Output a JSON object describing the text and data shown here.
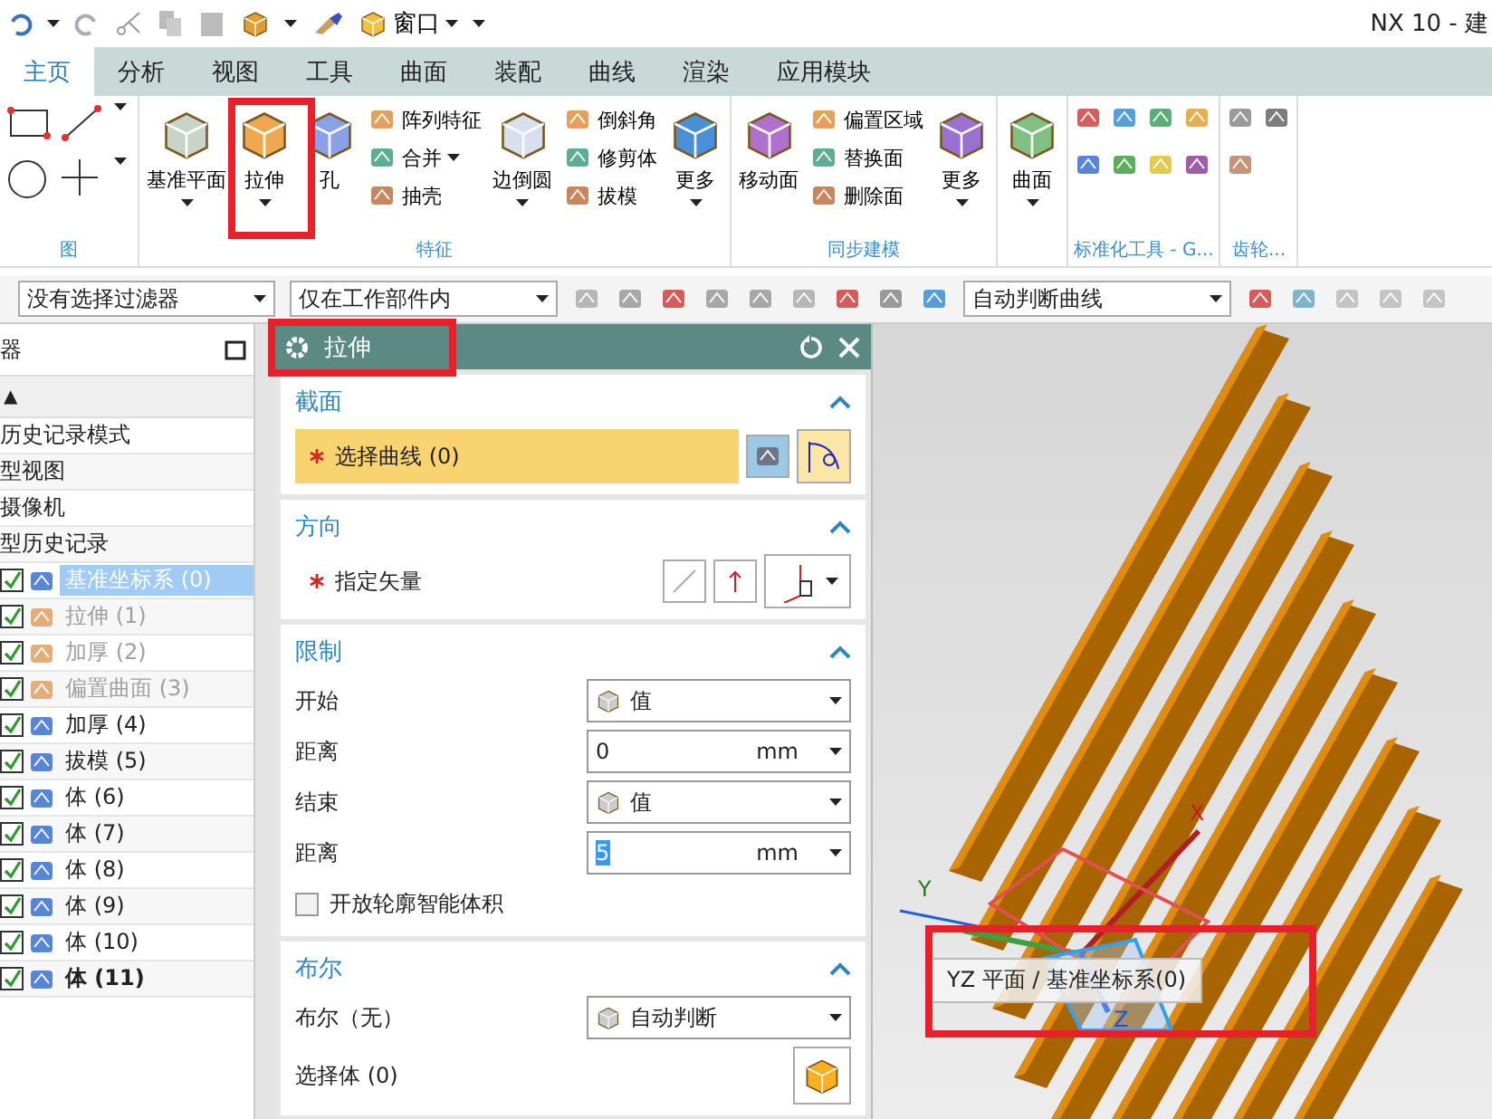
{
  "window": {
    "title": "NX 10 - 建",
    "menu": "窗口"
  },
  "tabs": [
    {
      "label": "主页",
      "selected": true
    },
    {
      "label": "分析",
      "selected": false
    },
    {
      "label": "视图",
      "selected": false
    },
    {
      "label": "工具",
      "selected": false
    },
    {
      "label": "曲面",
      "selected": false
    },
    {
      "label": "装配",
      "selected": false
    },
    {
      "label": "曲线",
      "selected": false
    },
    {
      "label": "渲染",
      "selected": false
    },
    {
      "label": "应用模块",
      "selected": false
    }
  ],
  "ribbon": {
    "groups": [
      {
        "kind": "sketch",
        "label": "图"
      },
      {
        "kind": "tools",
        "label": "特征",
        "items": [
          {
            "kind": "large",
            "label": "基准平面",
            "menu": true
          },
          {
            "kind": "large",
            "label": "拉伸",
            "menu": true
          },
          {
            "kind": "large",
            "label": "孔",
            "menu": false
          },
          {
            "kind": "small",
            "label": "阵列特征",
            "menu": false
          },
          {
            "kind": "small",
            "label": "合并",
            "menu": true
          },
          {
            "kind": "small",
            "label": "抽壳",
            "menu": false
          },
          {
            "kind": "large",
            "label": "边倒圆",
            "menu": true
          },
          {
            "kind": "small",
            "label": "倒斜角",
            "menu": false
          },
          {
            "kind": "small",
            "label": "修剪体",
            "menu": false
          },
          {
            "kind": "small",
            "label": "拔模",
            "menu": false
          },
          {
            "kind": "large",
            "label": "更多",
            "menu": true
          }
        ]
      },
      {
        "kind": "tools",
        "label": "同步建模",
        "items": [
          {
            "kind": "large",
            "label": "移动面",
            "menu": false
          },
          {
            "kind": "small",
            "label": "偏置区域",
            "menu": false
          },
          {
            "kind": "small",
            "label": "替换面",
            "menu": false
          },
          {
            "kind": "small",
            "label": "删除面",
            "menu": false
          },
          {
            "kind": "large",
            "label": "更多",
            "menu": true
          }
        ]
      },
      {
        "kind": "tools",
        "items": [
          {
            "kind": "large",
            "label": "曲面",
            "menu": true
          }
        ]
      },
      {
        "kind": "icons",
        "label": "标准化工具 - G..."
      },
      {
        "kind": "icons_narrow",
        "label": "齿轮..."
      }
    ]
  },
  "filter_bar": {
    "type_filter": "没有选择过滤器",
    "scope": "仅在工作部件内",
    "curve_rule": "自动判断曲线"
  },
  "navigator": {
    "title": "器",
    "sort_mark": "▲",
    "rows": [
      {
        "label": "历史记录模式"
      },
      {
        "label": "型视图"
      },
      {
        "label": "摄像机"
      },
      {
        "label": "型历史记录"
      }
    ],
    "features": [
      {
        "label": "基准坐标系 (0)",
        "checked": true,
        "selected": true,
        "suppressed": false,
        "current": false
      },
      {
        "label": "拉伸 (1)",
        "checked": true,
        "selected": false,
        "suppressed": true,
        "current": false
      },
      {
        "label": "加厚 (2)",
        "checked": true,
        "selected": false,
        "suppressed": true,
        "current": false
      },
      {
        "label": "偏置曲面 (3)",
        "checked": true,
        "selected": false,
        "suppressed": true,
        "current": false
      },
      {
        "label": "加厚 (4)",
        "checked": true,
        "selected": false,
        "suppressed": false,
        "current": false
      },
      {
        "label": "拔模 (5)",
        "checked": true,
        "selected": false,
        "suppressed": false,
        "current": false
      },
      {
        "label": "体 (6)",
        "checked": true,
        "selected": false,
        "suppressed": false,
        "current": false
      },
      {
        "label": "体 (7)",
        "checked": true,
        "selected": false,
        "suppressed": false,
        "current": false
      },
      {
        "label": "体 (8)",
        "checked": true,
        "selected": false,
        "suppressed": false,
        "current": false
      },
      {
        "label": "体 (9)",
        "checked": true,
        "selected": false,
        "suppressed": false,
        "current": false
      },
      {
        "label": "体 (10)",
        "checked": true,
        "selected": false,
        "suppressed": false,
        "current": false
      },
      {
        "label": "体 (11)",
        "checked": true,
        "selected": false,
        "suppressed": false,
        "current": true
      }
    ]
  },
  "dialog": {
    "title": "拉伸",
    "sections": [
      {
        "title": "截面",
        "expanded": true,
        "rows": [
          {
            "kind": "select",
            "label": "选择曲线 (0)",
            "required": true,
            "active": true
          }
        ]
      },
      {
        "title": "方向",
        "expanded": true,
        "rows": [
          {
            "kind": "vector",
            "label": "指定矢量",
            "required": true,
            "active": false
          }
        ]
      },
      {
        "title": "限制",
        "expanded": true,
        "rows": [
          {
            "kind": "dropdown",
            "label": "开始",
            "value": "值"
          },
          {
            "kind": "distance",
            "label": "距离",
            "value": "0",
            "unit": "mm",
            "value_selected": false
          },
          {
            "kind": "dropdown",
            "label": "结束",
            "value": "值"
          },
          {
            "kind": "distance",
            "label": "距离",
            "value": "5",
            "unit": "mm",
            "value_selected": true
          },
          {
            "kind": "checkbox",
            "label": "开放轮廓智能体积",
            "checked": false
          }
        ]
      },
      {
        "title": "布尔",
        "expanded": true,
        "rows": [
          {
            "kind": "dropdown",
            "label": "布尔（无）",
            "value": "自动判断"
          },
          {
            "kind": "body",
            "label": "选择体 (0)"
          }
        ]
      }
    ]
  },
  "viewport": {
    "tooltip": "YZ 平面 / 基准坐标系(0)",
    "axes": [
      "X",
      "Y",
      "Z"
    ]
  }
}
